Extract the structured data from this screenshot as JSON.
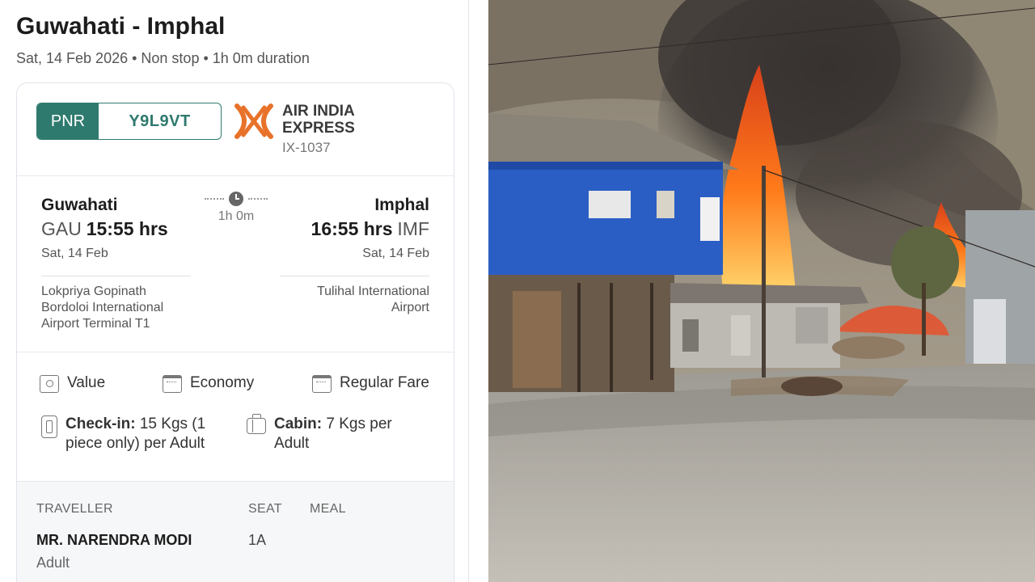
{
  "route": {
    "title": "Guwahati - Imphal",
    "subtitle": "Sat, 14 Feb 2026 • Non stop • 1h 0m duration"
  },
  "booking": {
    "pnr_label": "PNR",
    "pnr_value": "Y9L9VT",
    "airline_line1": "AIR INDIA",
    "airline_line2": "EXPRESS",
    "flight_number": "IX-1037"
  },
  "departure": {
    "city": "Guwahati",
    "code": "GAU",
    "time": "15:55 hrs",
    "date": "Sat, 14 Feb",
    "airport_line1": "Lokpriya Gopinath",
    "airport_line2": "Bordoloi International",
    "airport_line3": "Airport Terminal T1"
  },
  "arrival": {
    "city": "Imphal",
    "code": "IMF",
    "time": "16:55 hrs",
    "date": "Sat, 14 Feb",
    "airport_line1": "Tulihal International",
    "airport_line2": "Airport"
  },
  "duration": "1h 0m",
  "fare": {
    "fare_type": "Value",
    "cabin_class": "Economy",
    "fare_category": "Regular Fare"
  },
  "baggage": {
    "checkin_label": "Check-in:",
    "checkin_line1": "15 Kgs (1",
    "checkin_line2": "piece only) per Adult",
    "cabin_label": "Cabin:",
    "cabin_line1": "7 Kgs per",
    "cabin_line2": "Adult"
  },
  "traveller_table": {
    "headers": [
      "TRAVELLER",
      "SEAT",
      "MEAL"
    ],
    "rows": [
      {
        "name": "MR. NARENDRA MODI",
        "type": "Adult",
        "seat": "1A",
        "meal": ""
      }
    ]
  },
  "colors": {
    "brand_teal": "#2f7a6e",
    "airline_orange": "#e8722a"
  },
  "icons": [
    "money-icon",
    "calendar-icon",
    "calendar-icon",
    "luggage-icon",
    "briefcase-icon",
    "clock-icon"
  ]
}
